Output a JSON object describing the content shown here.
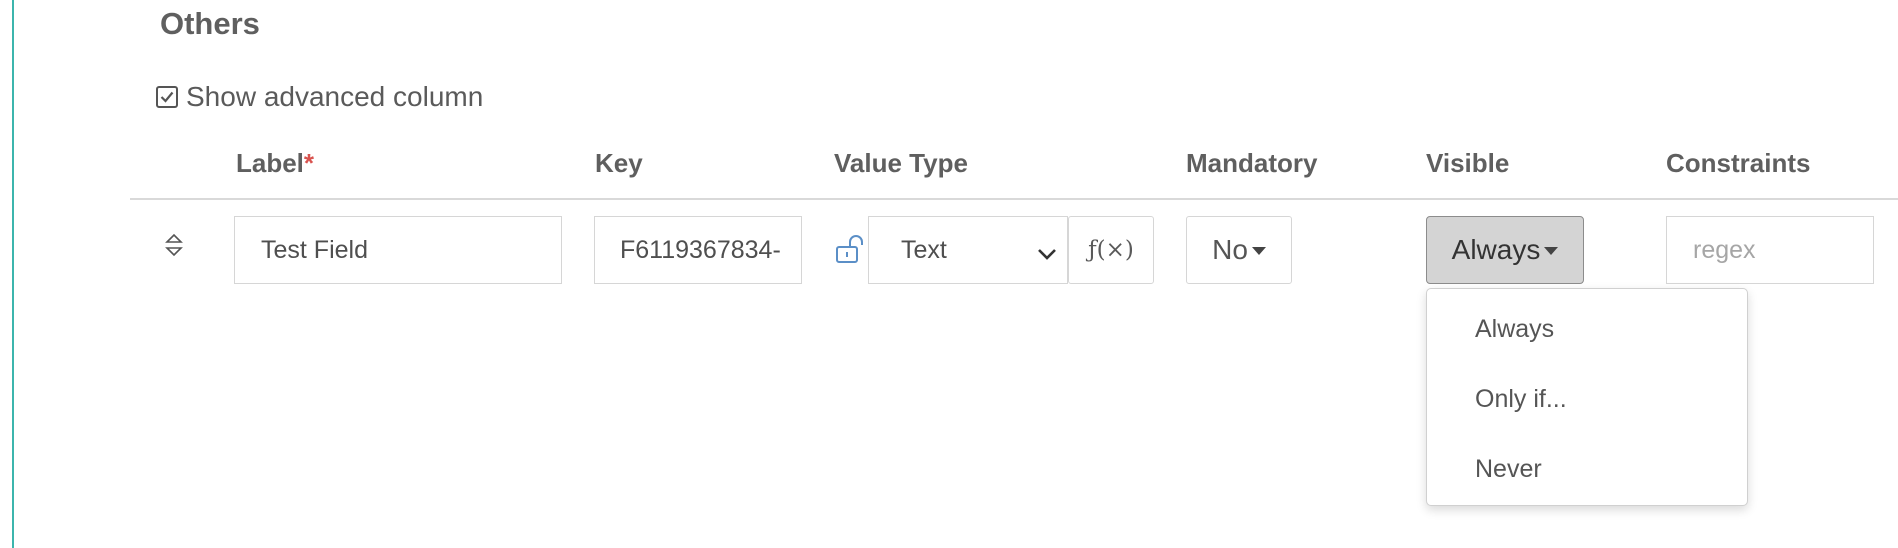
{
  "section": {
    "title": "Others"
  },
  "advanced": {
    "checked": true,
    "label": "Show advanced column"
  },
  "columns": {
    "label": "Label",
    "label_required_mark": "*",
    "key": "Key",
    "value_type": "Value Type",
    "mandatory": "Mandatory",
    "visible": "Visible",
    "constraints": "Constraints"
  },
  "row": {
    "label_value": "Test Field",
    "key_value": "F6119367834-",
    "value_type": "Text",
    "fx_label": "ƒ(×)",
    "mandatory": "No",
    "visible": "Always",
    "constraints_placeholder": "regex"
  },
  "visible_dropdown": {
    "options": [
      "Always",
      "Only if...",
      "Never"
    ]
  },
  "icons": {
    "drag": "sort-handle-icon",
    "lock": "unlock-icon",
    "checkbox": "checkbox-checked-icon",
    "chevron": "chevron-down-icon"
  },
  "colors": {
    "accent_bar": "#3cb5ad",
    "required": "#d9534f",
    "lock_icon": "#5b8fc7"
  }
}
